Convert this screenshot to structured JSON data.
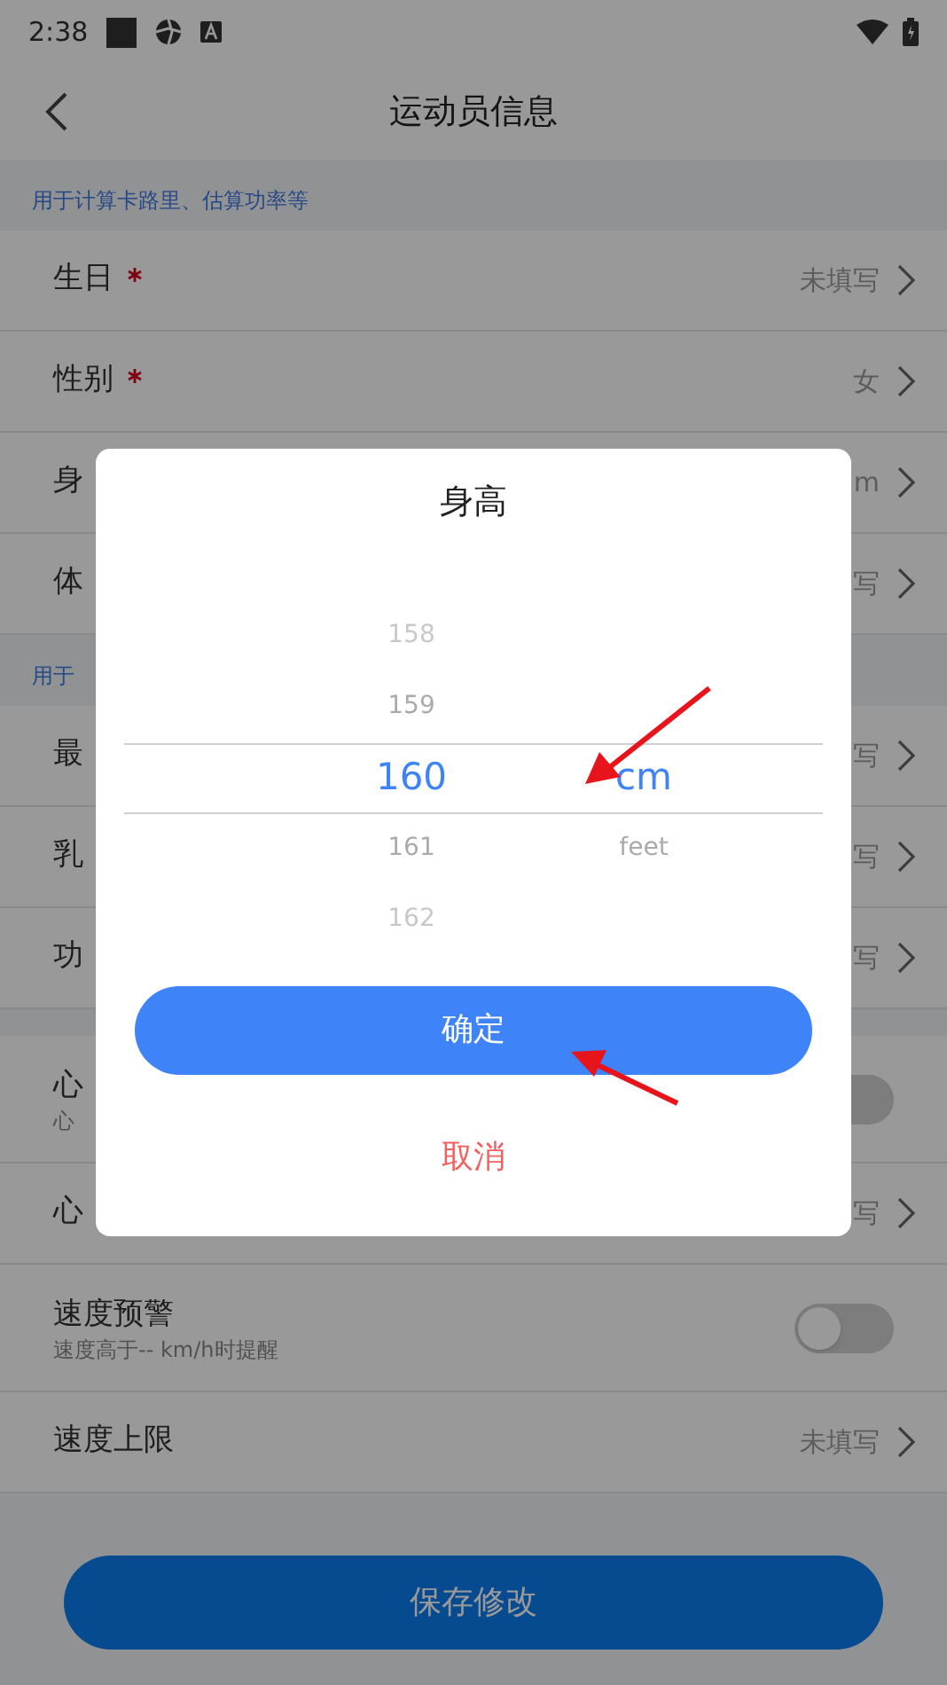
{
  "status_bar": {
    "time": "2:38"
  },
  "header": {
    "title": "运动员信息"
  },
  "sections": [
    {
      "caption": "用于计算卡路里、估算功率等",
      "rows": [
        {
          "kind": "nav",
          "label": "生日",
          "required": true,
          "value": "未填写"
        },
        {
          "kind": "nav",
          "label": "性别",
          "required": true,
          "value": "女"
        },
        {
          "kind": "nav",
          "label": "身",
          "value": "m"
        },
        {
          "kind": "nav",
          "label": "体",
          "value": "写"
        }
      ]
    },
    {
      "caption": "用于",
      "rows": [
        {
          "kind": "nav",
          "label": "最",
          "value": "写"
        },
        {
          "kind": "nav",
          "label": "乳",
          "value": "写"
        },
        {
          "kind": "nav",
          "label": "功",
          "value": "写"
        }
      ]
    },
    {
      "rows": [
        {
          "kind": "toggle",
          "label": "心",
          "sublabel": "心",
          "on": false
        },
        {
          "kind": "nav",
          "label": "心",
          "value": "写"
        },
        {
          "kind": "toggle",
          "label": "速度预警",
          "sublabel": "速度高于-- km/h时提醒",
          "on": false
        },
        {
          "kind": "nav",
          "label": "速度上限",
          "required": false,
          "value": "未填写"
        }
      ]
    }
  ],
  "save_button": "保存修改",
  "dialog": {
    "title": "身高",
    "numbers": [
      {
        "value": "158",
        "selected": false
      },
      {
        "value": "159",
        "selected": false
      },
      {
        "value": "160",
        "selected": true
      },
      {
        "value": "161",
        "selected": false
      },
      {
        "value": "162",
        "selected": false
      }
    ],
    "units": [
      {
        "value": "cm",
        "selected": true
      },
      {
        "value": "feet",
        "selected": false
      }
    ],
    "confirm": "确定",
    "cancel": "取消"
  }
}
